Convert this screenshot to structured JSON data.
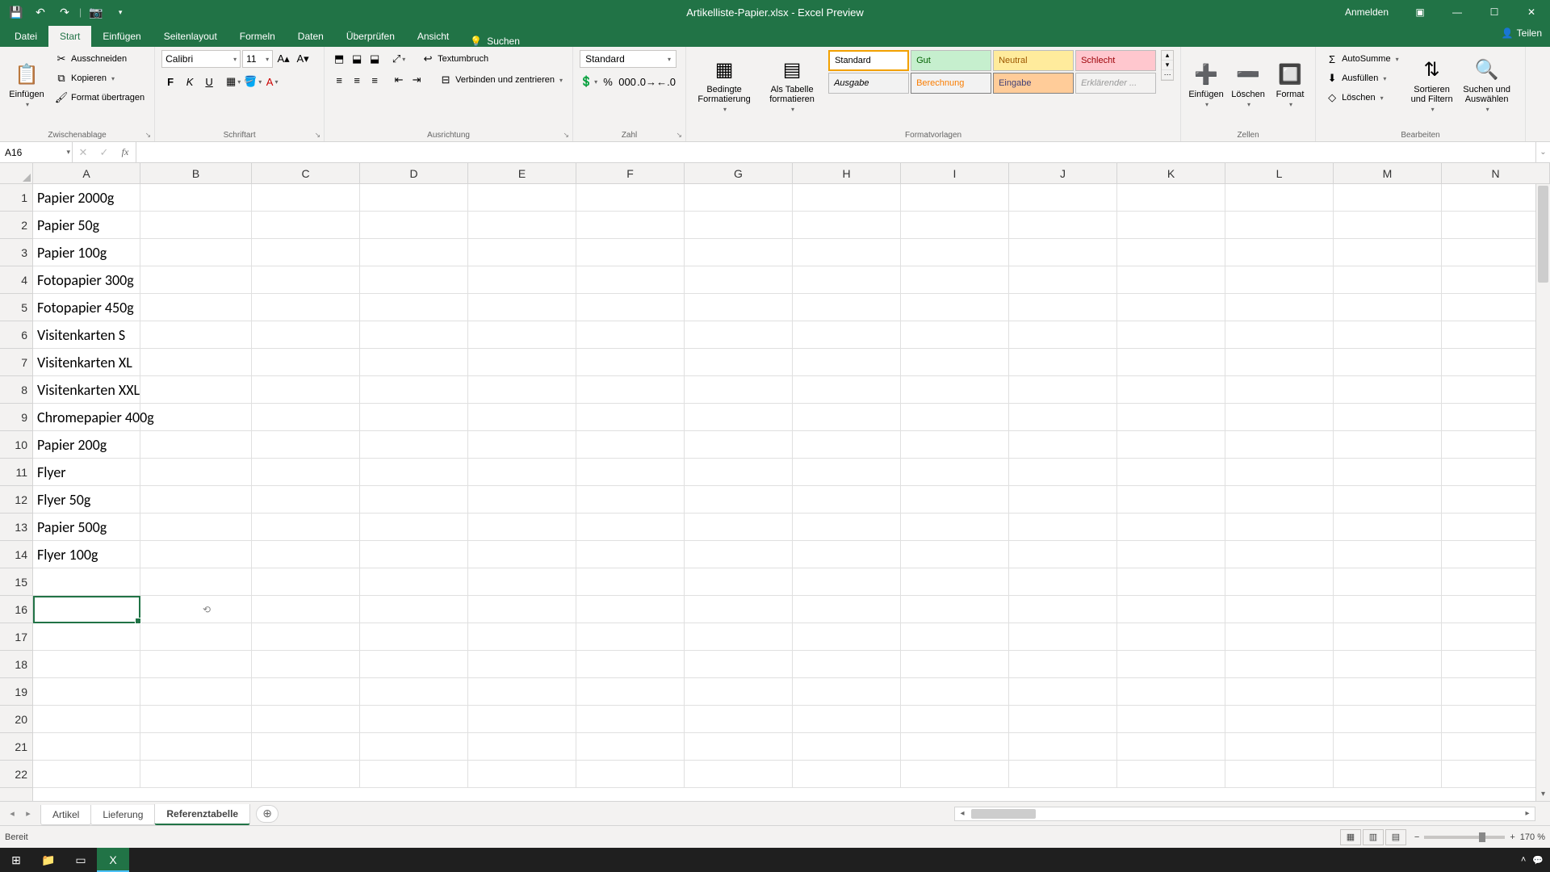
{
  "titlebar": {
    "title": "Artikelliste-Papier.xlsx - Excel Preview",
    "login": "Anmelden"
  },
  "tabs": {
    "datei": "Datei",
    "start": "Start",
    "einfuegen": "Einfügen",
    "seitenlayout": "Seitenlayout",
    "formeln": "Formeln",
    "daten": "Daten",
    "ueberpruefen": "Überprüfen",
    "ansicht": "Ansicht",
    "suchen": "Suchen",
    "teilen": "Teilen"
  },
  "ribbon": {
    "clipboard": {
      "einfuegen": "Einfügen",
      "ausschneiden": "Ausschneiden",
      "kopieren": "Kopieren",
      "format": "Format übertragen",
      "label": "Zwischenablage"
    },
    "font": {
      "name": "Calibri",
      "size": "11",
      "label": "Schriftart"
    },
    "align": {
      "wrap": "Textumbruch",
      "merge": "Verbinden und zentrieren",
      "label": "Ausrichtung"
    },
    "number": {
      "fmt": "Standard",
      "label": "Zahl"
    },
    "condfmt": {
      "bedingte": "Bedingte Formatierung",
      "als_tabelle": "Als Tabelle formatieren"
    },
    "styles": {
      "standard": "Standard",
      "gut": "Gut",
      "neutral": "Neutral",
      "schlecht": "Schlecht",
      "ausgabe": "Ausgabe",
      "berechnung": "Berechnung",
      "eingabe": "Eingabe",
      "erklaerender": "Erklärender ...",
      "label": "Formatvorlagen"
    },
    "cells": {
      "einfuegen": "Einfügen",
      "loeschen": "Löschen",
      "format": "Format",
      "label": "Zellen"
    },
    "editing": {
      "autosumme": "AutoSumme",
      "ausfuellen": "Ausfüllen",
      "loeschen": "Löschen",
      "sortieren": "Sortieren und Filtern",
      "suchen": "Suchen und Auswählen",
      "label": "Bearbeiten"
    }
  },
  "formula_bar": {
    "name_box": "A16",
    "formula": ""
  },
  "columns": [
    "A",
    "B",
    "C",
    "D",
    "E",
    "F",
    "G",
    "H",
    "I",
    "J",
    "K",
    "L",
    "M",
    "N"
  ],
  "rows": [
    {
      "n": 1,
      "A": "Papier 2000g"
    },
    {
      "n": 2,
      "A": "Papier 50g"
    },
    {
      "n": 3,
      "A": "Papier 100g"
    },
    {
      "n": 4,
      "A": "Fotopapier 300g"
    },
    {
      "n": 5,
      "A": "Fotopapier 450g"
    },
    {
      "n": 6,
      "A": "Visitenkarten S"
    },
    {
      "n": 7,
      "A": "Visitenkarten XL"
    },
    {
      "n": 8,
      "A": "Visitenkarten XXL"
    },
    {
      "n": 9,
      "A": "Chromepapier 400g"
    },
    {
      "n": 10,
      "A": "Papier 200g"
    },
    {
      "n": 11,
      "A": "Flyer"
    },
    {
      "n": 12,
      "A": "Flyer 50g"
    },
    {
      "n": 13,
      "A": "Papier 500g"
    },
    {
      "n": 14,
      "A": "Flyer 100g"
    },
    {
      "n": 15,
      "A": ""
    },
    {
      "n": 16,
      "A": ""
    },
    {
      "n": 17,
      "A": ""
    },
    {
      "n": 18,
      "A": ""
    },
    {
      "n": 19,
      "A": ""
    },
    {
      "n": 20,
      "A": ""
    },
    {
      "n": 21,
      "A": ""
    },
    {
      "n": 22,
      "A": ""
    }
  ],
  "sheets": {
    "artikel": "Artikel",
    "lieferung": "Lieferung",
    "referenz": "Referenztabelle"
  },
  "status": {
    "ready": "Bereit",
    "zoom": "170 %"
  },
  "selection": {
    "cell": "A16",
    "row_index": 15,
    "col": "A"
  }
}
